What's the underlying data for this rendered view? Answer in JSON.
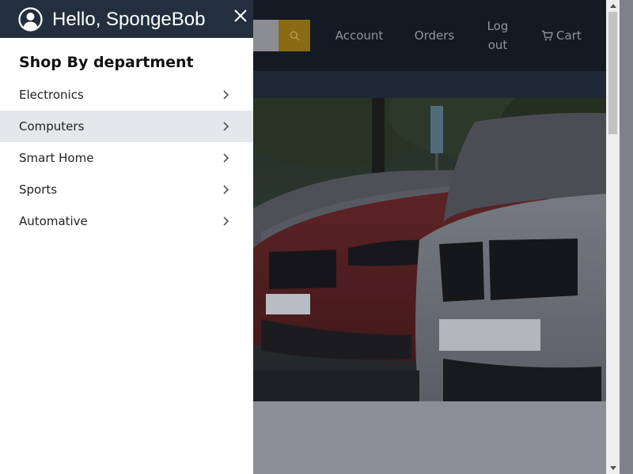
{
  "header": {
    "search_placeholder": "",
    "nav": {
      "account": "Account",
      "orders": "Orders",
      "logout": "Log out",
      "cart": "Cart"
    }
  },
  "drawer": {
    "greeting": "Hello, SpongeBob",
    "section_title": "Shop By department",
    "departments": [
      {
        "label": "Electronics",
        "active": false
      },
      {
        "label": "Computers",
        "active": true
      },
      {
        "label": "Smart Home",
        "active": false
      },
      {
        "label": "Sports",
        "active": false
      },
      {
        "label": "Automative",
        "active": false
      }
    ]
  },
  "colors": {
    "drawer_header_bg": "#232f3e",
    "topbar_bg": "#131a24",
    "search_button_bg": "#8a6a12",
    "active_item_bg": "#e6e7ea"
  },
  "icons": {
    "user": "user-circle-icon",
    "close": "close-icon",
    "search": "search-icon",
    "cart": "cart-icon",
    "chevron": "chevron-right-icon"
  }
}
